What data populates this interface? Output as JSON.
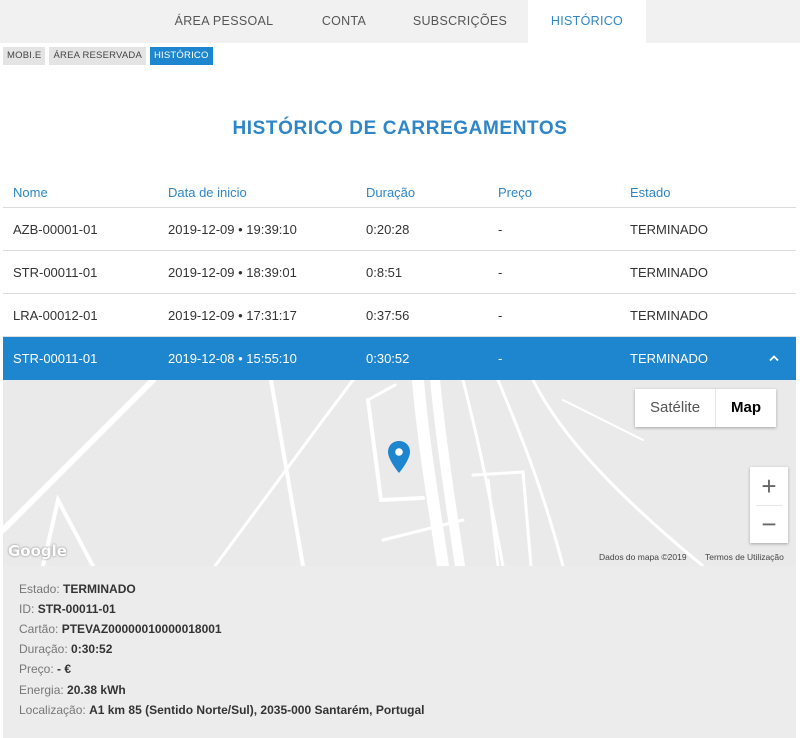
{
  "nav": {
    "tabs": [
      {
        "label": "ÁREA PESSOAL"
      },
      {
        "label": "CONTA"
      },
      {
        "label": "SUBSCRIÇÕES"
      },
      {
        "label": "HISTÓRICO"
      }
    ],
    "active_tab": "HISTÓRICO"
  },
  "breadcrumb": [
    {
      "label": "MOBI.E"
    },
    {
      "label": "ÁREA RESERVADA"
    },
    {
      "label": "HISTÓRICO"
    }
  ],
  "page_title": "HISTÓRICO DE CARREGAMENTOS",
  "table": {
    "headers": [
      "Nome",
      "Data de inicio",
      "Duração",
      "Preço",
      "Estado"
    ],
    "rows": [
      {
        "nome": "AZB-00001-01",
        "data": "2019-12-09 • 19:39:10",
        "duracao": "0:20:28",
        "preco": "-",
        "estado": "TERMINADO"
      },
      {
        "nome": "STR-00011-01",
        "data": "2019-12-09 • 18:39:01",
        "duracao": "0:8:51",
        "preco": "-",
        "estado": "TERMINADO"
      },
      {
        "nome": "LRA-00012-01",
        "data": "2019-12-09 • 17:31:17",
        "duracao": "0:37:56",
        "preco": "-",
        "estado": "TERMINADO"
      },
      {
        "nome": "STR-00011-01",
        "data": "2019-12-08 • 15:55:10",
        "duracao": "0:30:52",
        "preco": "-",
        "estado": "TERMINADO"
      }
    ],
    "expanded_row_icon": "chevron-up-icon"
  },
  "map": {
    "satellite_label": "Satélite",
    "map_label": "Map",
    "zoom_in": "+",
    "zoom_out": "−",
    "logo": "Google",
    "map_data": "Dados do mapa ©2019",
    "terms": "Termos de Utilização",
    "marker_icon": "map-pin-icon",
    "marker_color": "#1e86cf"
  },
  "details": [
    {
      "label": "Estado:",
      "value": "TERMINADO"
    },
    {
      "label": "ID:",
      "value": "STR-00011-01"
    },
    {
      "label": "Cartão:",
      "value": "PTEVAZ00000010000018001"
    },
    {
      "label": "Duração:",
      "value": "0:30:52"
    },
    {
      "label": "Preço:",
      "value": "- €"
    },
    {
      "label": "Energia:",
      "value": "20.38 kWh"
    },
    {
      "label": "Localização:",
      "value": "A1 km 85 (Sentido Norte/Sul), 2035-000 Santarém, Portugal"
    }
  ],
  "colors": {
    "accent": "#1e86cf",
    "nav_bg": "#f1f1f1",
    "details_bg": "#ececec"
  }
}
